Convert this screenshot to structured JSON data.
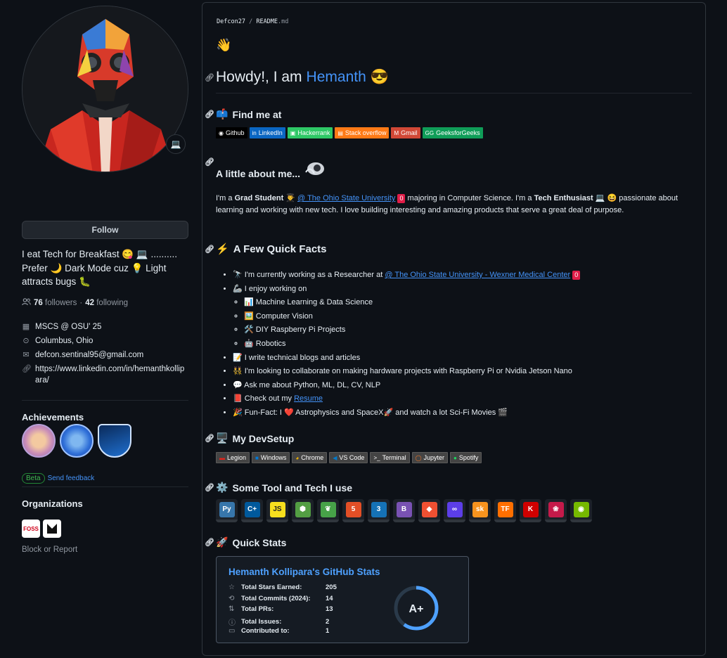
{
  "profile": {
    "status_emoji": "💻",
    "follow_label": "Follow",
    "bio_line1": "I eat Tech for Breakfast 😋 💻 ..........",
    "bio_line2": "Prefer 🌙 Dark Mode cuz 💡 Light",
    "bio_line3": "attracts bugs 🐛",
    "followers_count": "76",
    "followers_label": "followers",
    "dot": "·",
    "following_count": "42",
    "following_label": "following",
    "education": "MSCS @ OSU' 25",
    "location": "Columbus, Ohio",
    "email": "defcon.sentinal95@gmail.com",
    "website": "https://www.linkedin.com/in/hemanthkollipara/",
    "achievements_title": "Achievements",
    "beta_label": "Beta",
    "feedback_label": "Send feedback",
    "organizations_title": "Organizations",
    "org1_text": "FOSS",
    "block_label": "Block or Report"
  },
  "readme": {
    "breadcrumb_user": "Defcon27",
    "breadcrumb_sep": "/",
    "breadcrumb_file": "README",
    "breadcrumb_ext": ".md",
    "wave": "👋",
    "heading_prefix": "Howdy!, I am",
    "heading_name": "Hemanth",
    "heading_emoji": "😎",
    "find_title": "Find me at",
    "find_emoji": "📫",
    "badges": [
      {
        "label": "Github",
        "icon": "◉",
        "color": "#000000"
      },
      {
        "label": "LinkedIn",
        "icon": "in",
        "color": "#0a66c2"
      },
      {
        "label": "Hackerrank",
        "icon": "▣",
        "color": "#2ec866"
      },
      {
        "label": "Stack overflow",
        "icon": "▤",
        "color": "#fe7a16"
      },
      {
        "label": "Gmail",
        "icon": "M",
        "color": "#d14836"
      },
      {
        "label": "GeeksforGeeks",
        "icon": "GG",
        "color": "#0f9d58"
      }
    ],
    "about_title": "A little about me...",
    "about_p1_a": "I'm a ",
    "about_p1_b": "Grad Student",
    "about_p1_c": " 👨‍🎓 ",
    "about_link": "@ The Ohio State University",
    "about_p1_d": "majoring in Computer Science. I'm a ",
    "about_p1_e": "Tech Enthusiast",
    "about_p1_f": " 💻 😆 passionate about",
    "about_p2": "learning and working with new tech. I love building interesting and amazing products that serve a great deal of purpose.",
    "zero": "0",
    "facts_title": "A Few Quick Facts",
    "facts_emoji": "⚡",
    "fact1_a": "🔭 I'm currently working as a Researcher at ",
    "fact1_link": "@ The Ohio State University - Wexner Medical Center",
    "fact2": "🦾 I enjoy working on",
    "sub1": "📊 Machine Learning & Data Science",
    "sub2": "🖼️ Computer Vision",
    "sub3": "🛠️ DIY Raspberry Pi Projects",
    "sub4": "🤖 Robotics",
    "fact3": "📝 I write technical blogs and articles",
    "fact4": "👯 I'm looking to collaborate on making hardware projects with Raspberry Pi or Nvidia Jetson Nano",
    "fact5": "💬 Ask me about Python, ML, DL, CV, NLP",
    "fact6_a": "📕 Check out my ",
    "fact6_link": "Resume",
    "fact7": "🎉 Fun-Fact: I ❤️ Astrophysics and SpaceX🚀 and watch a lot Sci-Fi Movies 🎬",
    "devsetup_title": "My DevSetup",
    "devsetup_emoji": "🖥️",
    "setup_badges": [
      {
        "label": "Legion",
        "icon": "▬",
        "color": "#e2231a"
      },
      {
        "label": "Windows",
        "icon": "■",
        "color": "#0078d6"
      },
      {
        "label": "Chrome",
        "icon": "◕",
        "color": "#f4b400"
      },
      {
        "label": "VS Code",
        "icon": "◀",
        "color": "#007acc"
      },
      {
        "label": "Terminal",
        "icon": ">_",
        "color": "#ffffff"
      },
      {
        "label": "Jupyter",
        "icon": "◯",
        "color": "#f37626"
      },
      {
        "label": "Spotify",
        "icon": "●",
        "color": "#1ed760"
      }
    ],
    "tools_title": "Some Tool and Tech I use",
    "tools_emoji": "⚙️",
    "tools": [
      {
        "name": "python-icon",
        "text": "Py",
        "color": "#3776ab"
      },
      {
        "name": "cplusplus-icon",
        "text": "C+",
        "color": "#00599c"
      },
      {
        "name": "javascript-icon",
        "text": "JS",
        "color": "#f7df1e"
      },
      {
        "name": "nodejs-icon",
        "text": "⬢",
        "color": "#539e43"
      },
      {
        "name": "mongodb-icon",
        "text": "❦",
        "color": "#47a248"
      },
      {
        "name": "html5-icon",
        "text": "5",
        "color": "#e34f26"
      },
      {
        "name": "css3-icon",
        "text": "3",
        "color": "#1572b6"
      },
      {
        "name": "bootstrap-icon",
        "text": "B",
        "color": "#7952b3"
      },
      {
        "name": "git-icon",
        "text": "◆",
        "color": "#f05032"
      },
      {
        "name": "opencv-icon",
        "text": "∞",
        "color": "#5c3ee8"
      },
      {
        "name": "scikit-learn-icon",
        "text": "sk",
        "color": "#f7931e"
      },
      {
        "name": "tensorflow-icon",
        "text": "TF",
        "color": "#ff6f00"
      },
      {
        "name": "keras-icon",
        "text": "K",
        "color": "#d00000"
      },
      {
        "name": "raspberrypi-icon",
        "text": "❀",
        "color": "#c51a4a"
      },
      {
        "name": "nvidia-icon",
        "text": "◉",
        "color": "#76b900"
      }
    ],
    "stats_title_section": "Quick Stats",
    "stats_emoji": "🚀"
  },
  "stats_card": {
    "title": "Hemanth Kollipara's GitHub Stats",
    "rows": [
      {
        "label": "Total Stars Earned:",
        "value": "205",
        "icon": "☆"
      },
      {
        "label": "Total Commits (2024):",
        "value": "14",
        "icon": "⟲"
      },
      {
        "label": "Total PRs:",
        "value": "13",
        "icon": "⇅"
      },
      {
        "label": "Total Issues:",
        "value": "2",
        "icon": "ⓘ"
      },
      {
        "label": "Contributed to:",
        "value": "1",
        "icon": "▭"
      }
    ],
    "grade": "A+",
    "grade_progress": 0.6,
    "accent": "#4ea1ff"
  }
}
